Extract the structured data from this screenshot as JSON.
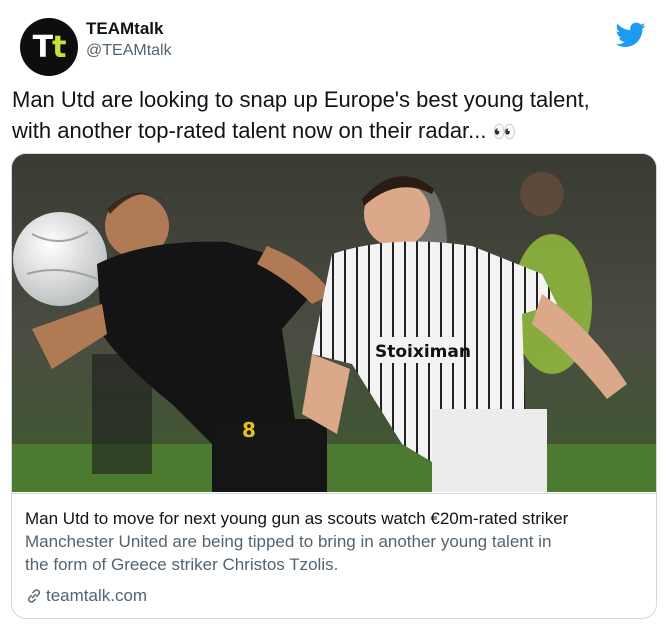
{
  "account": {
    "display_name": "TEAMtalk",
    "handle": "@TEAMtalk",
    "avatar_letters": [
      "T",
      "t"
    ]
  },
  "platform_icon": "twitter-bird-icon",
  "tweet": {
    "line1": "Man Utd are looking to snap up Europe's best young talent,",
    "line2": "with another top-rated talent now on their radar...",
    "emoji": "👀"
  },
  "card": {
    "image_description_icon": "football-match-photo",
    "shirt_sponsor": "Stoiximan",
    "shirt_number": "8",
    "title": "Man Utd to move for next young gun as scouts watch €20m-rated striker",
    "description_line1": "Manchester United are being tipped to bring in another young talent in",
    "description_line2": "the form of Greece striker Christos Tzolis.",
    "domain": "teamtalk.com",
    "domain_icon": "link-icon"
  },
  "colors": {
    "twitter_blue": "#1d9bf0",
    "text_primary": "#0f1419",
    "text_secondary": "#536471",
    "border": "#cfd9de",
    "avatar_accent": "#c8e03a"
  }
}
